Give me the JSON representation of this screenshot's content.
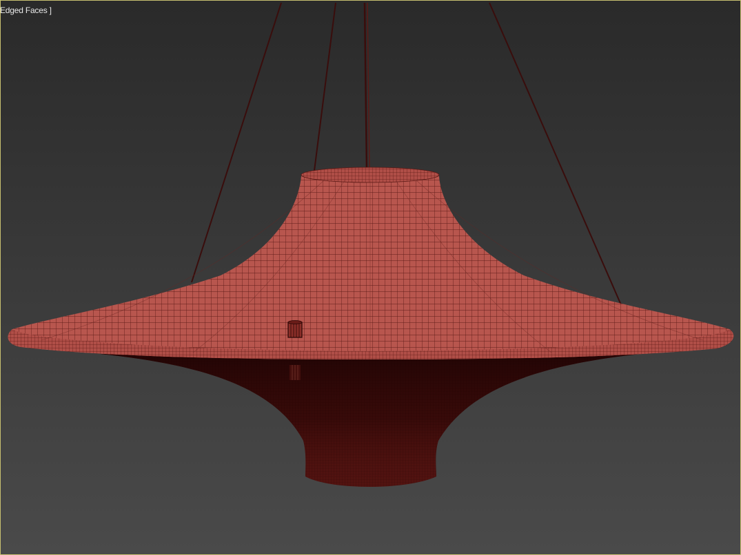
{
  "viewport": {
    "shading_label": "Edged Faces ]",
    "colors": {
      "background_top": "#2a2a2a",
      "background_bottom": "#4a4a4a",
      "active_border": "#c8c070",
      "mesh_fill": "#b5524a",
      "mesh_wire": "#5a1a16",
      "mesh_underside": "#3a0c0a",
      "cable": "#3a0d0c"
    }
  },
  "scene": {
    "object": "pendant-lamp-shade",
    "icons": [
      "pendant-lamp-shade-icon",
      "suspension-cable-icon",
      "pull-cord-weight-icon"
    ]
  }
}
